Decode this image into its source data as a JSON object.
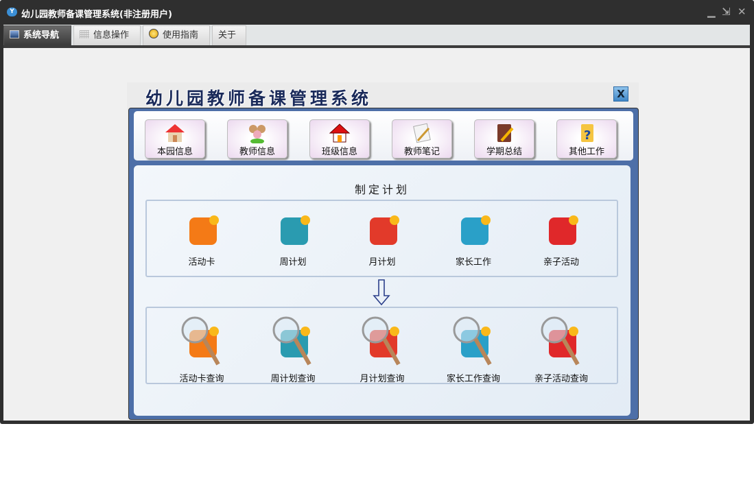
{
  "window": {
    "title": "幼儿园教师备课管理系统(非注册用户)",
    "logo_text": "Y"
  },
  "window_controls": {
    "minimize": "▁",
    "restore": "⇲",
    "close": "✕"
  },
  "tabs": [
    {
      "label": "系统导航",
      "icon": "monitor-icon",
      "active": true
    },
    {
      "label": "信息操作",
      "icon": "grid-icon"
    },
    {
      "label": "使用指南",
      "icon": "help-icon"
    },
    {
      "label": "关于"
    }
  ],
  "panel": {
    "title": "幼儿园教师备课管理系统",
    "close": "X"
  },
  "toolbar": [
    {
      "label": "本园信息",
      "icon": "house-icon"
    },
    {
      "label": "教师信息",
      "icon": "users-icon"
    },
    {
      "label": "班级信息",
      "icon": "home-icon"
    },
    {
      "label": "教师笔记",
      "icon": "notes-icon"
    },
    {
      "label": "学期总结",
      "icon": "notebook-icon"
    },
    {
      "label": "其他工作",
      "icon": "folder-help-icon"
    }
  ],
  "plan": {
    "title": "制定计划",
    "items": [
      {
        "label": "活动卡",
        "color": "#f47a16"
      },
      {
        "label": "周计划",
        "color": "#2a9bb0"
      },
      {
        "label": "月计划",
        "color": "#e23a2a"
      },
      {
        "label": "家长工作",
        "color": "#2aa0c8"
      },
      {
        "label": "亲子活动",
        "color": "#e0282a"
      }
    ]
  },
  "query": {
    "items": [
      {
        "label": "活动卡查询",
        "color": "#f47a16"
      },
      {
        "label": "周计划查询",
        "color": "#2a9bb0"
      },
      {
        "label": "月计划查询",
        "color": "#e23a2a"
      },
      {
        "label": "家长工作查询",
        "color": "#2aa0c8"
      },
      {
        "label": "亲子活动查询",
        "color": "#e0282a"
      }
    ]
  }
}
